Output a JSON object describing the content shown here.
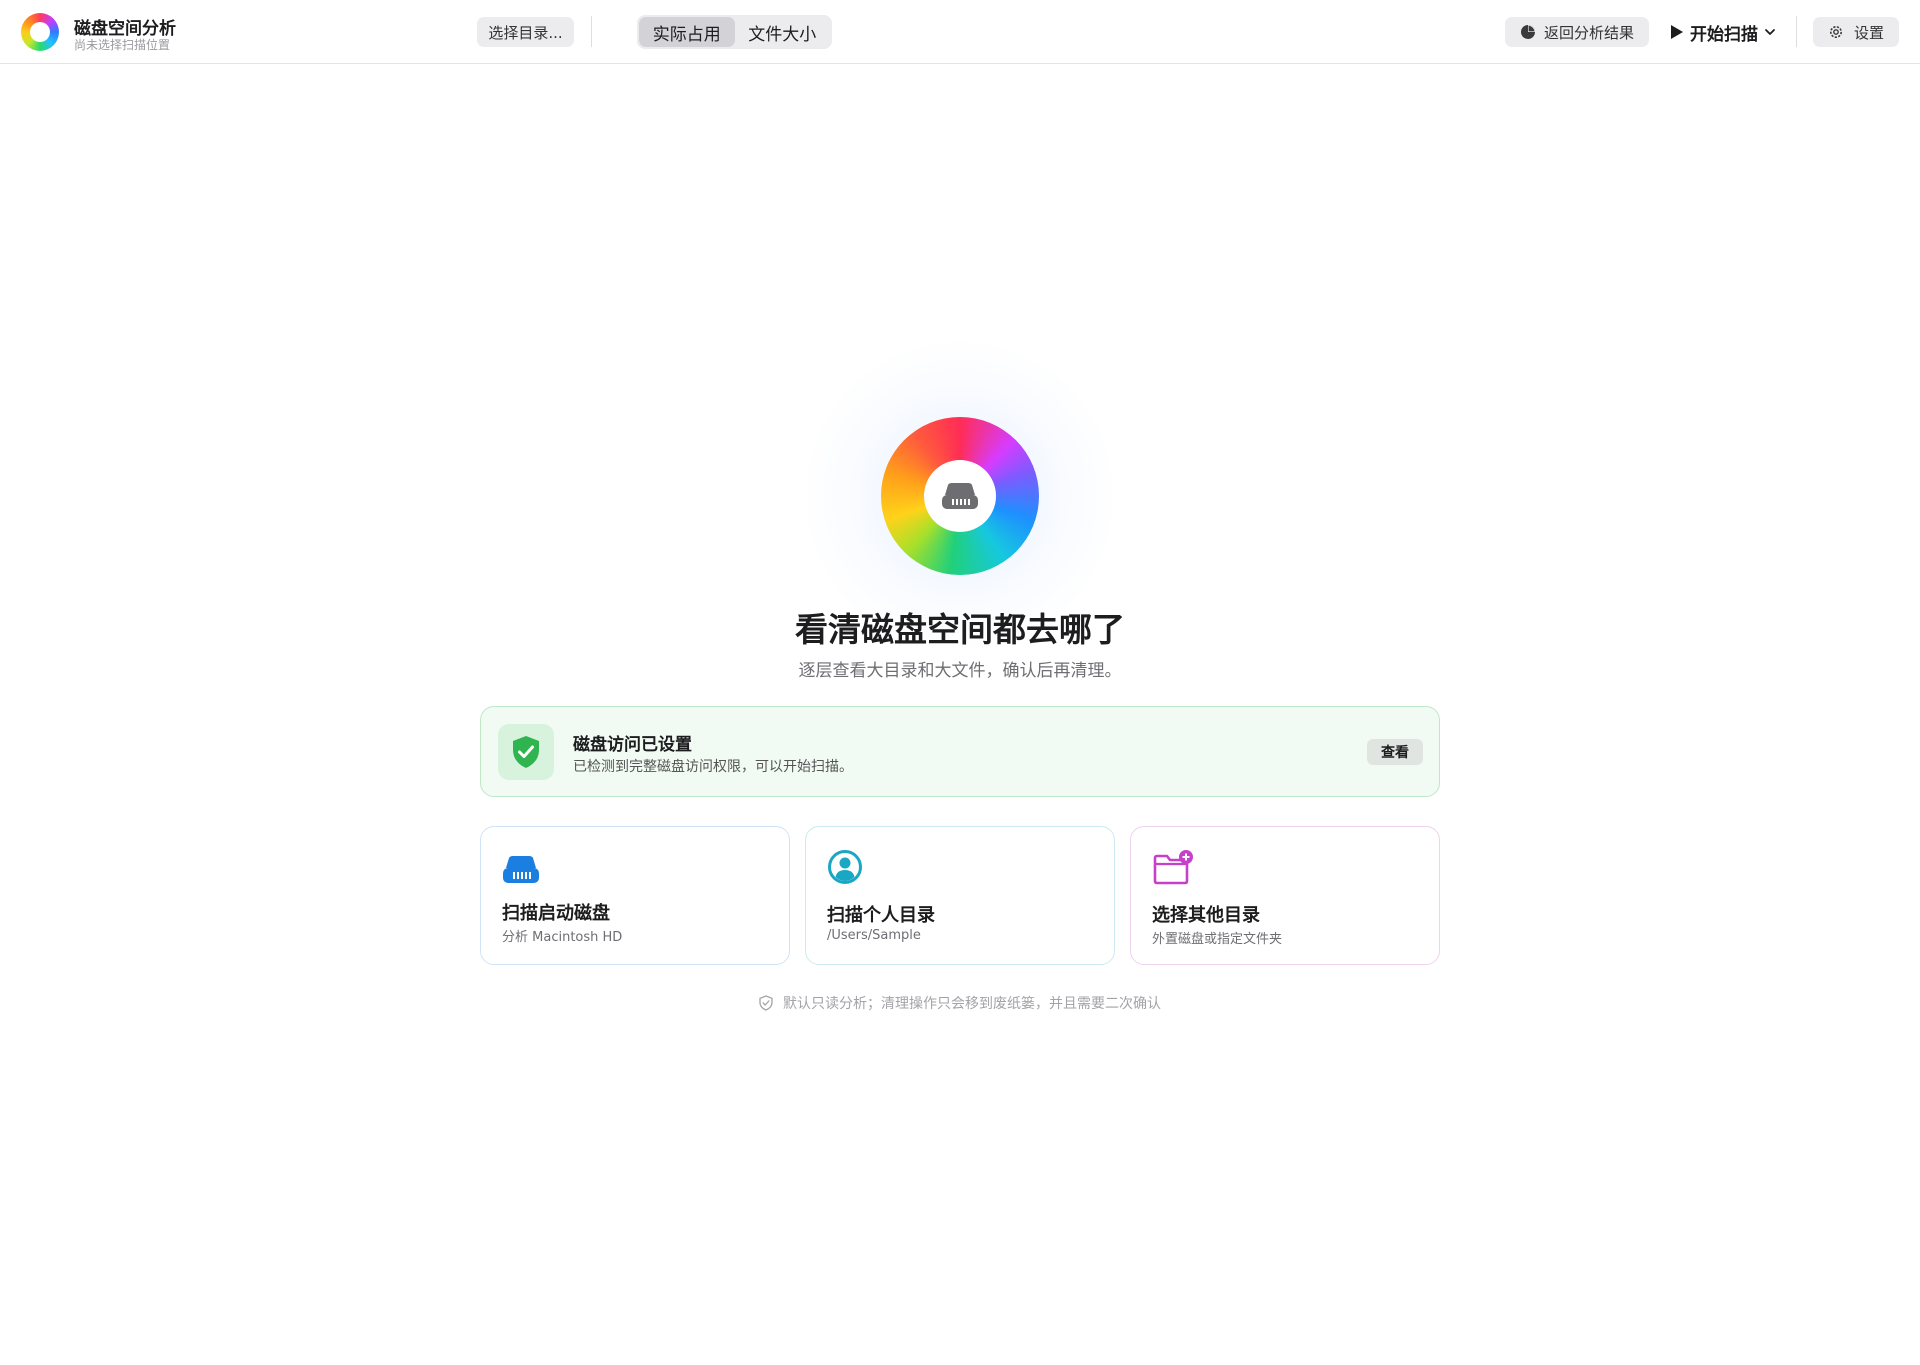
{
  "app": {
    "title": "磁盘空间分析",
    "subtitle": "尚未选择扫描位置"
  },
  "toolbar": {
    "choose_dir_label": "选择目录...",
    "size_mode": {
      "options": [
        "实际占用",
        "文件大小"
      ],
      "selected": "实际占用"
    },
    "back_label": "返回分析结果",
    "scan_label": "开始扫描",
    "settings_label": "设置"
  },
  "hero": {
    "title": "看清磁盘空间都去哪了",
    "subtitle": "逐层查看大目录和大文件，确认后再清理。"
  },
  "permission": {
    "title": "磁盘访问已设置",
    "description": "已检测到完整磁盘访问权限，可以开始扫描。",
    "view_label": "查看"
  },
  "actions": [
    {
      "title": "扫描启动磁盘",
      "description": "分析 Macintosh HD",
      "icon": "hard-drive-icon"
    },
    {
      "title": "扫描个人目录",
      "description": "/Users/Sample",
      "icon": "user-circle-icon"
    },
    {
      "title": "选择其他目录",
      "description": "外置磁盘或指定文件夹",
      "icon": "folder-plus-icon"
    }
  ],
  "footer": {
    "note": "默认只读分析；清理操作只会移到废纸篓，并且需要二次确认"
  },
  "colors": {
    "accent_blue": "#1a7fe0",
    "accent_teal": "#1aa7c4",
    "accent_magenta": "#c640c9",
    "success_green": "#2fb44f",
    "permission_bg": "#f1faf3"
  }
}
